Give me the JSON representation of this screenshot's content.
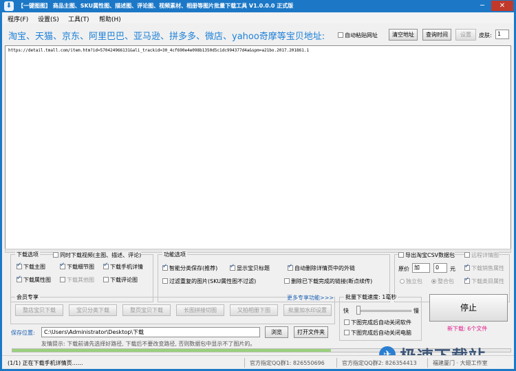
{
  "window": {
    "title": "【一键图图】 商品主图、SKU属性图、描述图、评论图、视频素材、相册等图片批量下载工具 V1.0.0.0 正式版",
    "min_label": "─",
    "close_label": "✕"
  },
  "menu": [
    "程序(F)",
    "设置(S)",
    "工具(T)",
    "帮助(H)"
  ],
  "top": {
    "platforms_text": "淘宝、天猫、京东、阿里巴巴、亚马逊、拼多多、微店、yahoo奇摩等宝贝地址:",
    "auto_paste_label": "自动粘贴网址",
    "clear_button": "清空地址",
    "query_time_button": "查询时间",
    "settings_button": "设置",
    "skin_label": "皮肤:",
    "skin_value": "1"
  },
  "url_value": "https://detail.tmall.com/item.htm?id=570424966131&ali_trackid=30_4cf690e4e098b1350d5c1dc994377d4a&spm=a21bo.2017.201861.1",
  "download_options": {
    "title": "下载选项",
    "sync_video": "同时下载视频(主图、描述、评论)",
    "main_image": "下载主图",
    "detail_image": "下载细节图",
    "mobile_detail": "下载手机详情",
    "attr_image": "下载属性图",
    "other_image": "下载其他图",
    "review_image": "下载评论图"
  },
  "function_options": {
    "title": "功能选项",
    "smart_classify": "智能分类保存(推荐)",
    "show_title": "显示宝贝标题",
    "auto_delete_links": "自动删除详情页中的外链",
    "filter_duplicate": "过滤重复的图片(SKU属性图不过滤)",
    "delete_done_links": "删除已下载完成的链接(断点续传)"
  },
  "csv": {
    "export_label": "导出淘宝CSV数据包",
    "remote_detail": "远程详情图",
    "price_label": "原价",
    "price_op": "加",
    "price_value": "0",
    "yuan": "元",
    "download_sales_attr": "下载销售属性",
    "standalone_pkg": "独立包",
    "merged_pkg": "整合包",
    "download_category_attr": "下载类目属性"
  },
  "member": {
    "title": "会员专享",
    "more_link": "更多专享功能>>>",
    "buttons": [
      "整店宝贝下载",
      "宝贝分类下载",
      "整页宝贝下载",
      "长图拼接切图",
      "又拍相册下图",
      "批量加水印设置"
    ]
  },
  "batch_speed": {
    "title": "批量下载速度: 1毫秒",
    "fast": "快",
    "slow": "慢",
    "speed_level": 0.05,
    "close_after_software": "下图完成后自动关闭软件",
    "close_after_computer": "下图完成后自动关闭电脑"
  },
  "stop_button": "停止",
  "download_status": "新下载: 6个文件",
  "save": {
    "label": "保存位置:",
    "path": "C:\\Users\\Administrator\\Desktop\\下载",
    "browse": "浏览",
    "open_folder": "打开文件夹",
    "tip": "友情提示: 下载前请先选择好路径, 下载后不要改变路径, 否则数据包中显示不了图片的。"
  },
  "progress_fraction": 0.64,
  "status": {
    "message": "(1/1) 正在下载手机详情页……",
    "qq1": "官方指定QQ群1: 826550696",
    "qq2": "官方指定QQ群2: 826354413",
    "company": "福建厦门 · 大翅工作室"
  },
  "watermark": {
    "text": "极速下载站",
    "logo": "✈"
  }
}
